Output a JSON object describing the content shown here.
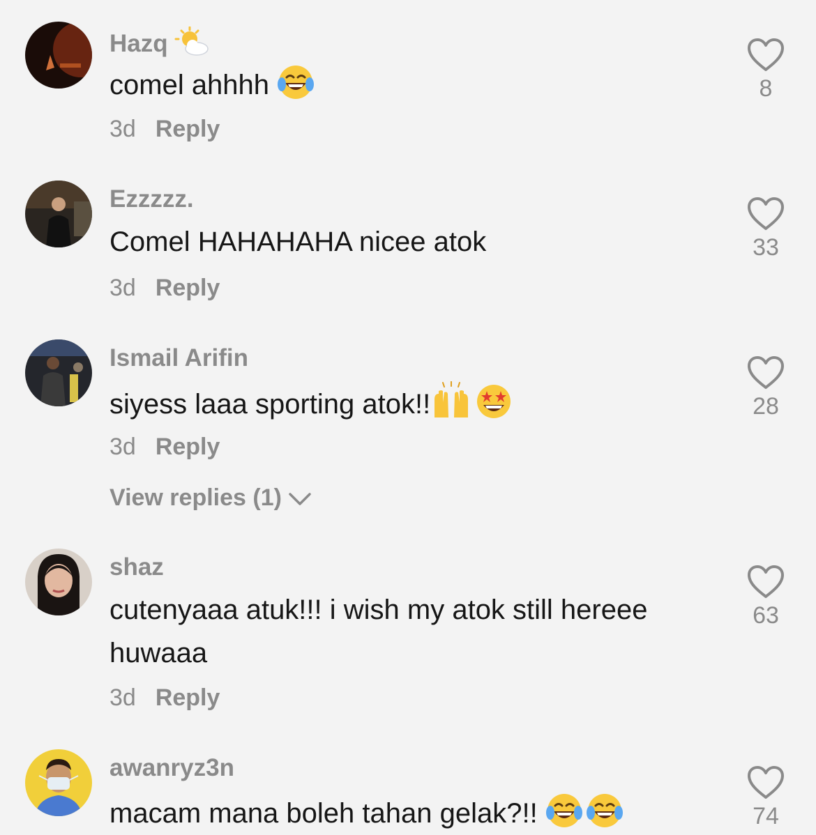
{
  "comments": [
    {
      "username": "Hazq",
      "username_emoji": "sun-behind-cloud-icon",
      "text": "comel ahhhh",
      "text_emojis": [
        "tears-of-joy-icon"
      ],
      "time": "3d",
      "reply_label": "Reply",
      "likes": "8"
    },
    {
      "username": "Ezzzzz.",
      "text": "Comel HAHAHAHA nicee atok",
      "time": "3d",
      "reply_label": "Reply",
      "likes": "33"
    },
    {
      "username": "Ismail Arifin",
      "text": "siyess laaa sporting atok!!",
      "text_emojis": [
        "raising-hands-icon",
        "star-struck-icon"
      ],
      "time": "3d",
      "reply_label": "Reply",
      "likes": "28",
      "view_replies": "View replies (1)"
    },
    {
      "username": "shaz",
      "text": "cutenyaaa atuk!!! i wish my atok still hereee huwaaa",
      "time": "3d",
      "reply_label": "Reply",
      "likes": "63"
    },
    {
      "username": "awanryz3n",
      "text": "macam mana boleh tahan gelak?!!",
      "text_emojis": [
        "tears-of-joy-icon",
        "tears-of-joy-icon"
      ],
      "likes": "74"
    }
  ],
  "colors": {
    "background": "#f3f3f3",
    "text": "#161616",
    "muted": "#8a8a8a"
  }
}
